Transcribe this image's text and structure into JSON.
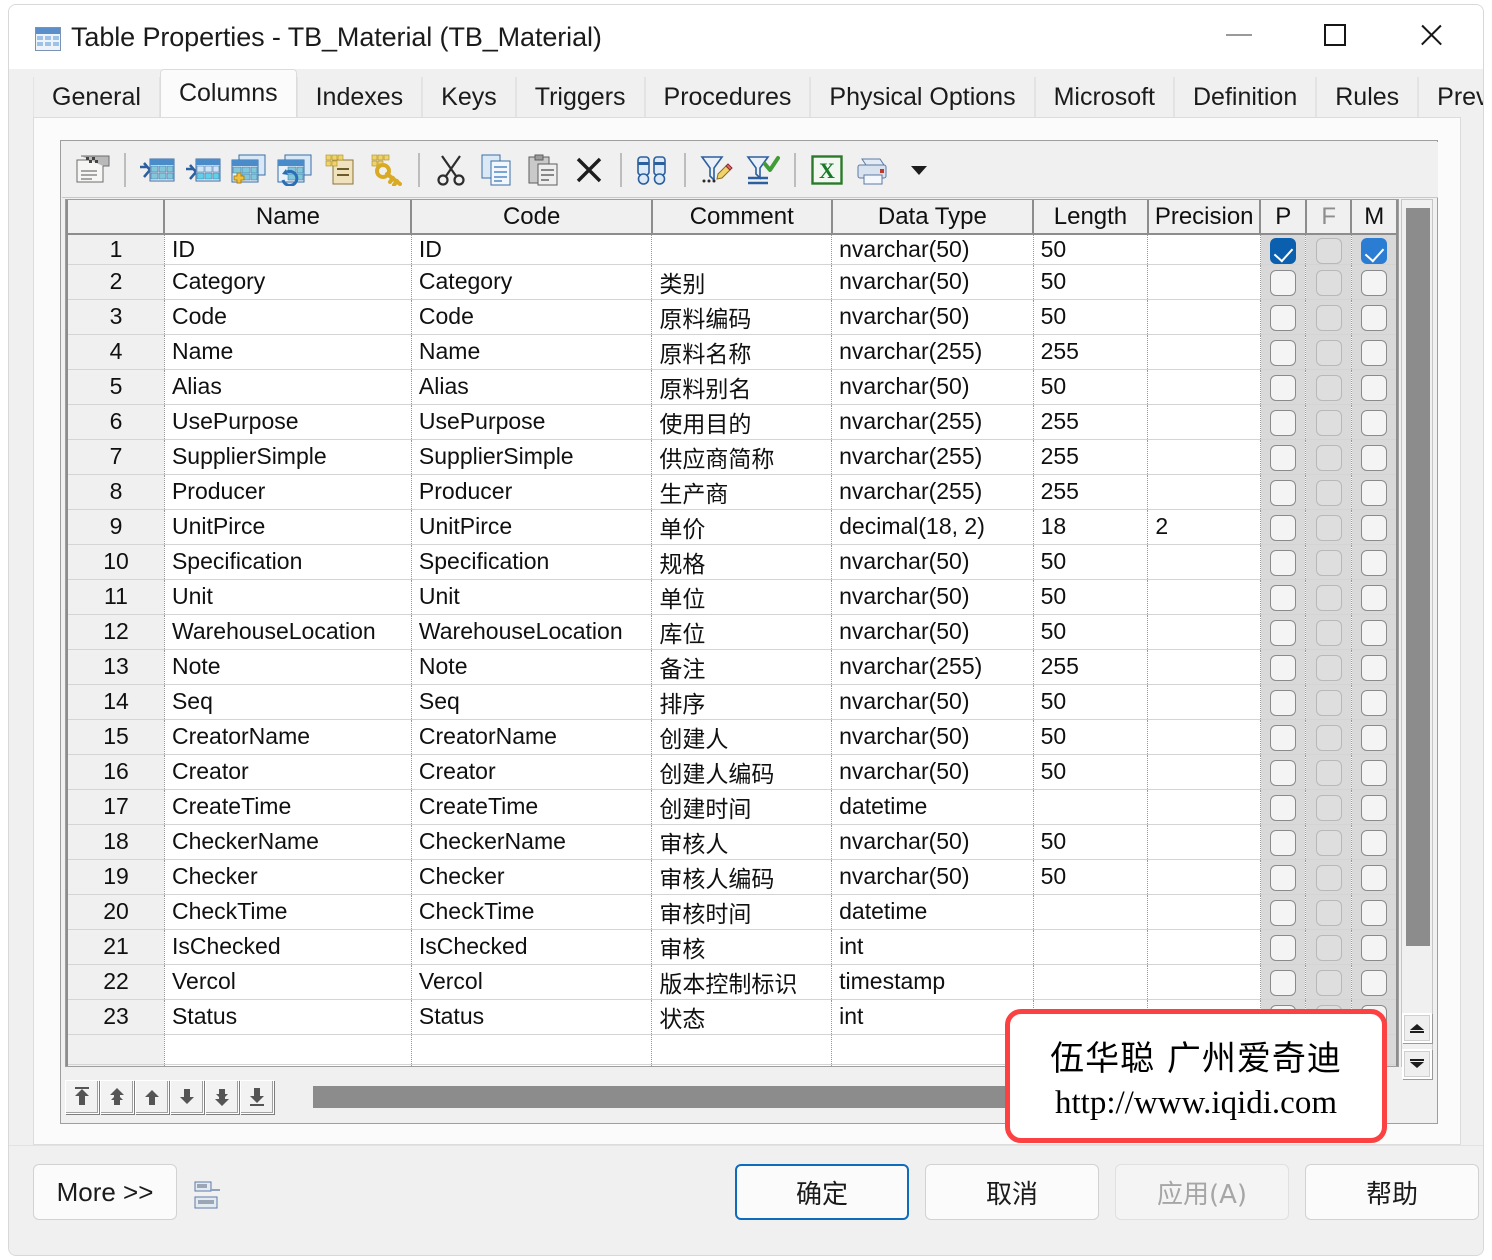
{
  "window": {
    "title": "Table Properties - TB_Material (TB_Material)",
    "icon": "table-icon",
    "minimize_label": "—",
    "maximize_label": "□",
    "close_label": "✕"
  },
  "tabs": [
    {
      "label": "General",
      "active": false
    },
    {
      "label": "Columns",
      "active": true
    },
    {
      "label": "Indexes",
      "active": false
    },
    {
      "label": "Keys",
      "active": false
    },
    {
      "label": "Triggers",
      "active": false
    },
    {
      "label": "Procedures",
      "active": false
    },
    {
      "label": "Physical Options",
      "active": false
    },
    {
      "label": "Microsoft",
      "active": false
    },
    {
      "label": "Definition",
      "active": false
    },
    {
      "label": "Rules",
      "active": false
    },
    {
      "label": "Preview",
      "active": false
    }
  ],
  "toolbar": {
    "buttons": [
      {
        "name": "properties-icon"
      },
      {
        "name": "insert-column-icon"
      },
      {
        "name": "add-column-icon"
      },
      {
        "name": "add-a-column-icon"
      },
      {
        "name": "replace-column-icon"
      },
      {
        "name": "add-note-icon"
      },
      {
        "name": "add-key-icon"
      },
      {
        "name": "cut-icon"
      },
      {
        "name": "copy-icon"
      },
      {
        "name": "paste-icon"
      },
      {
        "name": "delete-icon"
      },
      {
        "name": "find-icon"
      },
      {
        "name": "customize-columns-icon"
      },
      {
        "name": "filter-icon"
      },
      {
        "name": "export-excel-icon"
      },
      {
        "name": "print-icon"
      },
      {
        "name": "dropdown-arrow-icon"
      }
    ]
  },
  "grid": {
    "headers": [
      "",
      "Name",
      "Code",
      "Comment",
      "Data Type",
      "Length",
      "Precision",
      "P",
      "F",
      "M"
    ],
    "rows": [
      {
        "n": "1",
        "name": "ID",
        "code": "ID",
        "comment": "",
        "type": "nvarchar(50)",
        "length": "50",
        "precision": "",
        "p": true,
        "f": false,
        "m": true
      },
      {
        "n": "2",
        "name": "Category",
        "code": "Category",
        "comment": "类别",
        "type": "nvarchar(50)",
        "length": "50",
        "precision": "",
        "p": false,
        "f": false,
        "m": false
      },
      {
        "n": "3",
        "name": "Code",
        "code": "Code",
        "comment": "原料编码",
        "type": "nvarchar(50)",
        "length": "50",
        "precision": "",
        "p": false,
        "f": false,
        "m": false
      },
      {
        "n": "4",
        "name": "Name",
        "code": "Name",
        "comment": "原料名称",
        "type": "nvarchar(255)",
        "length": "255",
        "precision": "",
        "p": false,
        "f": false,
        "m": false
      },
      {
        "n": "5",
        "name": "Alias",
        "code": "Alias",
        "comment": "原料别名",
        "type": "nvarchar(50)",
        "length": "50",
        "precision": "",
        "p": false,
        "f": false,
        "m": false
      },
      {
        "n": "6",
        "name": "UsePurpose",
        "code": "UsePurpose",
        "comment": "使用目的",
        "type": "nvarchar(255)",
        "length": "255",
        "precision": "",
        "p": false,
        "f": false,
        "m": false
      },
      {
        "n": "7",
        "name": "SupplierSimple",
        "code": "SupplierSimple",
        "comment": "供应商简称",
        "type": "nvarchar(255)",
        "length": "255",
        "precision": "",
        "p": false,
        "f": false,
        "m": false
      },
      {
        "n": "8",
        "name": "Producer",
        "code": "Producer",
        "comment": "生产商",
        "type": "nvarchar(255)",
        "length": "255",
        "precision": "",
        "p": false,
        "f": false,
        "m": false
      },
      {
        "n": "9",
        "name": "UnitPirce",
        "code": "UnitPirce",
        "comment": "单价",
        "type": "decimal(18, 2)",
        "length": "18",
        "precision": "2",
        "p": false,
        "f": false,
        "m": false
      },
      {
        "n": "10",
        "name": "Specification",
        "code": "Specification",
        "comment": "规格",
        "type": "nvarchar(50)",
        "length": "50",
        "precision": "",
        "p": false,
        "f": false,
        "m": false
      },
      {
        "n": "11",
        "name": "Unit",
        "code": "Unit",
        "comment": "单位",
        "type": "nvarchar(50)",
        "length": "50",
        "precision": "",
        "p": false,
        "f": false,
        "m": false
      },
      {
        "n": "12",
        "name": "WarehouseLocation",
        "code": "WarehouseLocation",
        "comment": "库位",
        "type": "nvarchar(50)",
        "length": "50",
        "precision": "",
        "p": false,
        "f": false,
        "m": false
      },
      {
        "n": "13",
        "name": "Note",
        "code": "Note",
        "comment": "备注",
        "type": "nvarchar(255)",
        "length": "255",
        "precision": "",
        "p": false,
        "f": false,
        "m": false
      },
      {
        "n": "14",
        "name": "Seq",
        "code": "Seq",
        "comment": "排序",
        "type": "nvarchar(50)",
        "length": "50",
        "precision": "",
        "p": false,
        "f": false,
        "m": false
      },
      {
        "n": "15",
        "name": "CreatorName",
        "code": "CreatorName",
        "comment": "创建人",
        "type": "nvarchar(50)",
        "length": "50",
        "precision": "",
        "p": false,
        "f": false,
        "m": false
      },
      {
        "n": "16",
        "name": "Creator",
        "code": "Creator",
        "comment": "创建人编码",
        "type": "nvarchar(50)",
        "length": "50",
        "precision": "",
        "p": false,
        "f": false,
        "m": false
      },
      {
        "n": "17",
        "name": "CreateTime",
        "code": "CreateTime",
        "comment": "创建时间",
        "type": "datetime",
        "length": "",
        "precision": "",
        "p": false,
        "f": false,
        "m": false
      },
      {
        "n": "18",
        "name": "CheckerName",
        "code": "CheckerName",
        "comment": "审核人",
        "type": "nvarchar(50)",
        "length": "50",
        "precision": "",
        "p": false,
        "f": false,
        "m": false
      },
      {
        "n": "19",
        "name": "Checker",
        "code": "Checker",
        "comment": "审核人编码",
        "type": "nvarchar(50)",
        "length": "50",
        "precision": "",
        "p": false,
        "f": false,
        "m": false
      },
      {
        "n": "20",
        "name": "CheckTime",
        "code": "CheckTime",
        "comment": "审核时间",
        "type": "datetime",
        "length": "",
        "precision": "",
        "p": false,
        "f": false,
        "m": false
      },
      {
        "n": "21",
        "name": "IsChecked",
        "code": "IsChecked",
        "comment": "审核",
        "type": "int",
        "length": "",
        "precision": "",
        "p": false,
        "f": false,
        "m": false
      },
      {
        "n": "22",
        "name": "Vercol",
        "code": "Vercol",
        "comment": "版本控制标识",
        "type": "timestamp",
        "length": "",
        "precision": "",
        "p": false,
        "f": false,
        "m": false
      },
      {
        "n": "23",
        "name": "Status",
        "code": "Status",
        "comment": "状态",
        "type": "int",
        "length": "",
        "precision": "",
        "p": false,
        "f": false,
        "m": false
      }
    ],
    "blank_row_count": 6
  },
  "row_nav": {
    "buttons": [
      {
        "name": "move-to-first-button"
      },
      {
        "name": "move-up-far-button"
      },
      {
        "name": "move-up-button"
      },
      {
        "name": "move-down-button"
      },
      {
        "name": "move-down-far-button"
      },
      {
        "name": "move-to-last-button"
      }
    ]
  },
  "watermark": {
    "line1": "伍华聪 广州爱奇迪",
    "line2": "http://www.iqidi.com",
    "border_color": "#fb4141"
  },
  "footer": {
    "more_label": "More >>",
    "config_icon": "column-config-icon",
    "ok_label": "确定",
    "cancel_label": "取消",
    "apply_label": "应用(A)",
    "help_label": "帮助"
  },
  "colors": {
    "accent": "#0f6cbd",
    "checked_primary": "#0a5fae",
    "checked_mandatory": "#2b7cd3",
    "window_bg": "#f0f0f0",
    "page_bg": "#fbfbfb"
  }
}
